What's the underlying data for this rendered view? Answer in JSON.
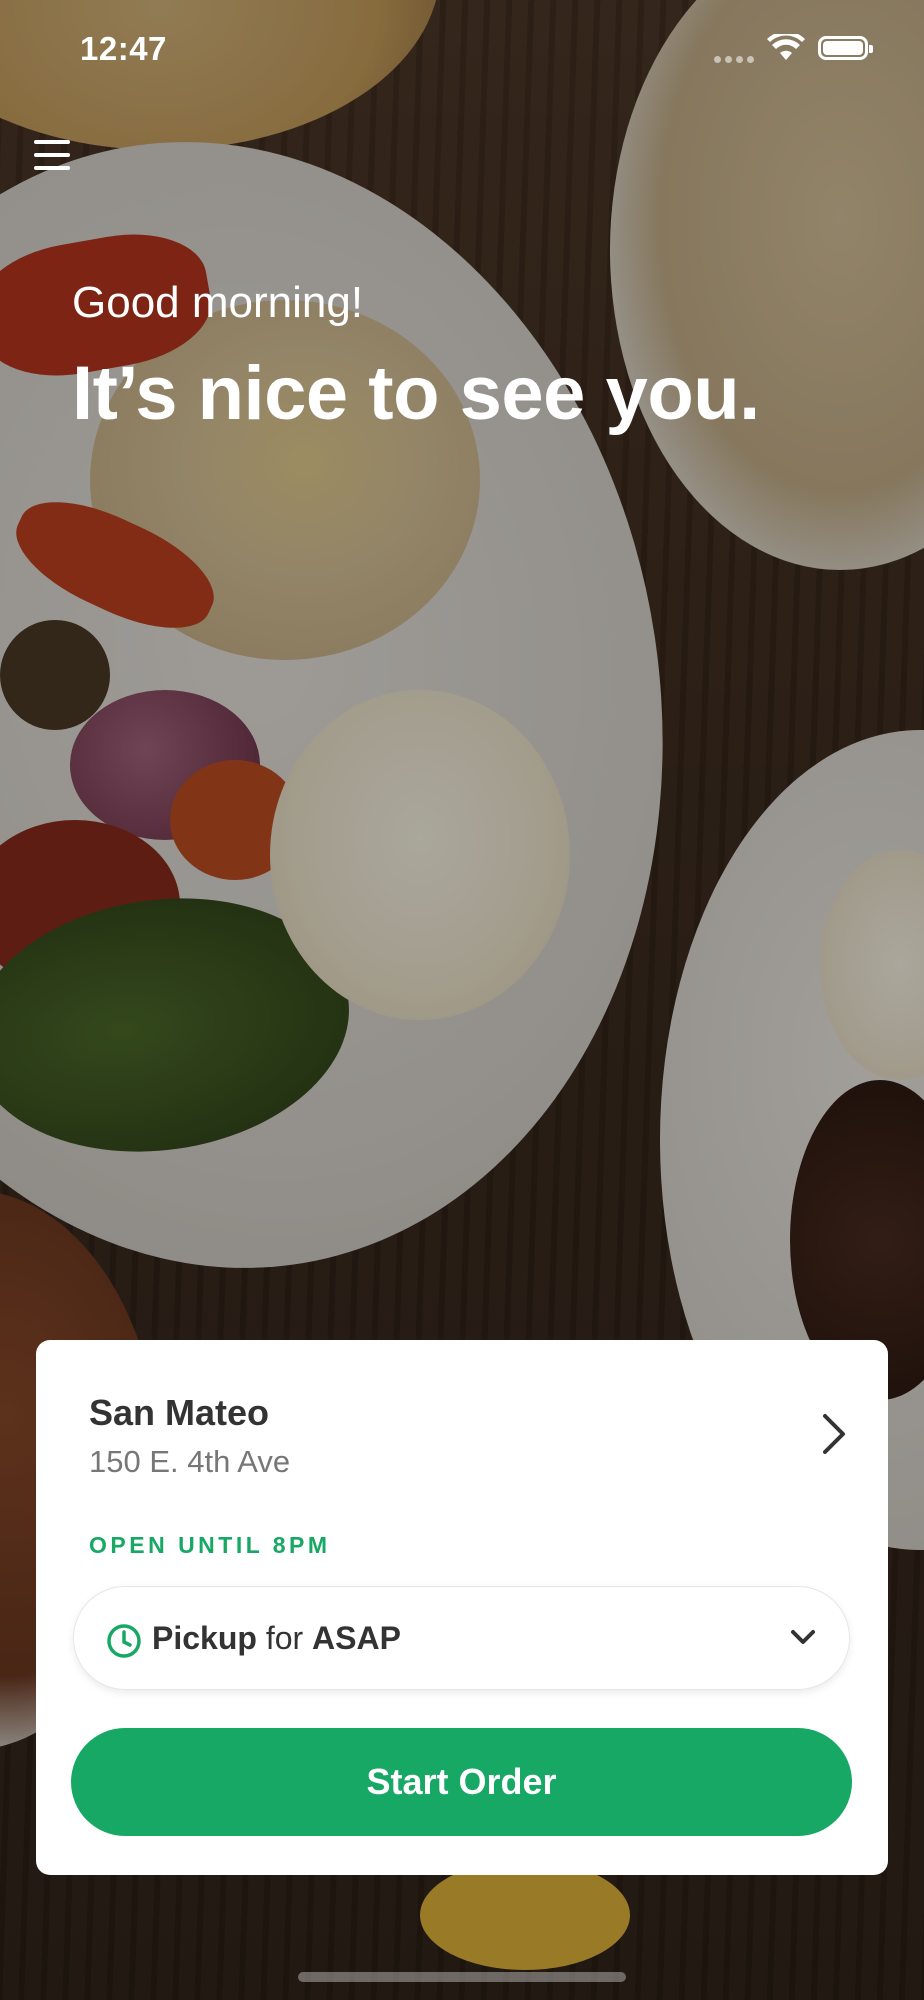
{
  "status_bar": {
    "time": "12:47"
  },
  "hero": {
    "greeting": "Good morning!",
    "headline": "It’s nice to see you."
  },
  "store": {
    "name": "San Mateo",
    "address": "150 E. 4th Ave",
    "hours_status": "OPEN UNTIL 8PM"
  },
  "order_mode": {
    "method": "Pickup",
    "connector": "for",
    "time": "ASAP"
  },
  "start_button": {
    "label": "Start Order"
  },
  "colors": {
    "accent": "#17a865",
    "card": "#ffffff",
    "text_dark": "#333333",
    "text_muted": "#777777"
  },
  "icons": [
    "menu-icon",
    "wifi-icon",
    "battery-icon",
    "chevron-right-icon",
    "clock-icon",
    "chevron-down-icon"
  ]
}
